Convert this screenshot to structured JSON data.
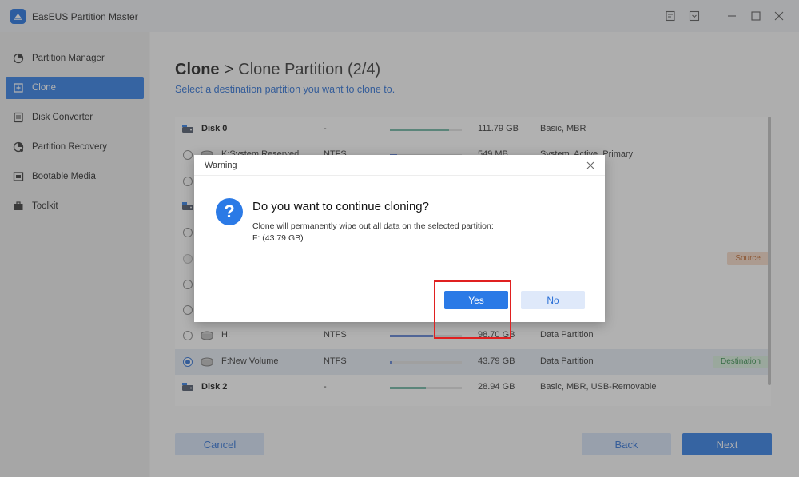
{
  "app": {
    "title": "EasEUS Partition Master"
  },
  "titlebar_icons": [
    "feedback-icon",
    "dropdown-menu-icon",
    "minimize-icon",
    "maximize-icon",
    "close-icon"
  ],
  "sidebar": {
    "items": [
      {
        "label": "Partition Manager",
        "icon": "pie-chart-icon",
        "active": false
      },
      {
        "label": "Clone",
        "icon": "clone-icon",
        "active": true
      },
      {
        "label": "Disk Converter",
        "icon": "disk-converter-icon",
        "active": false
      },
      {
        "label": "Partition Recovery",
        "icon": "partition-recovery-icon",
        "active": false
      },
      {
        "label": "Bootable Media",
        "icon": "bootable-media-icon",
        "active": false
      },
      {
        "label": "Toolkit",
        "icon": "toolkit-icon",
        "active": false
      }
    ]
  },
  "main": {
    "breadcrumb_root": "Clone",
    "breadcrumb_sep": ">",
    "breadcrumb_sub": "Clone Partition (2/4)",
    "subtitle": "Select a destination partition you want to clone to.",
    "rows": [
      {
        "kind": "disk",
        "name": "Disk 0",
        "fs": "-",
        "usage": 0.82,
        "size": "111.79 GB",
        "type": "Basic, MBR"
      },
      {
        "kind": "partition",
        "name": "K:System Reserved",
        "fs": "NTFS",
        "usage": 0.1,
        "size": "549 MB",
        "type": "System, Active, Primary"
      },
      {
        "kind": "partition",
        "name": "",
        "fs": "",
        "usage": 0,
        "size": "",
        "type": ""
      },
      {
        "kind": "disk",
        "name": "",
        "fs": "",
        "usage": 0,
        "size": "",
        "type": ""
      },
      {
        "kind": "partition",
        "name": "",
        "fs": "",
        "usage": 0,
        "size": "",
        "type": ""
      },
      {
        "kind": "source",
        "name": "",
        "fs": "",
        "usage": 0,
        "size": "",
        "type": "",
        "badge": "Source"
      },
      {
        "kind": "partition",
        "name": "",
        "fs": "",
        "usage": 0,
        "size": "",
        "type": ""
      },
      {
        "kind": "partition",
        "name": "",
        "fs": "",
        "usage": 0,
        "size": "",
        "type": ""
      },
      {
        "kind": "partition",
        "name": "H:",
        "fs": "NTFS",
        "usage": 0.6,
        "size": "98.70 GB",
        "type": "Data Partition"
      },
      {
        "kind": "selected",
        "name": "F:New Volume",
        "fs": "NTFS",
        "usage": 0.01,
        "size": "43.79 GB",
        "type": "Data Partition",
        "badge": "Destination"
      },
      {
        "kind": "disk",
        "name": "Disk 2",
        "fs": "-",
        "usage": 0.5,
        "size": "28.94 GB",
        "type": "Basic, MBR, USB-Removable"
      }
    ],
    "buttons": {
      "cancel": "Cancel",
      "back": "Back",
      "next": "Next"
    }
  },
  "dialog": {
    "title": "Warning",
    "heading": "Do you want to continue cloning?",
    "message_line1": "Clone will permanently wipe out all data on the selected partition:",
    "message_line2": "F: (43.79 GB)",
    "yes_label": "Yes",
    "no_label": "No"
  },
  "colors": {
    "accent": "#2b7ae6",
    "usage_disk": "#6bb3a0",
    "usage_partition": "#5b7fd4",
    "source_badge_bg": "#f6d9c6",
    "source_badge_text": "#c0662a",
    "destination_badge_bg": "#d8f0dd",
    "destination_badge_text": "#2f8a47",
    "highlight_border": "#e02020"
  }
}
